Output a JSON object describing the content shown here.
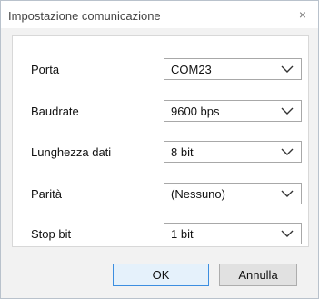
{
  "window": {
    "title": "Impostazione comunicazione",
    "close_glyph": "×"
  },
  "form": {
    "rows": [
      {
        "label": "Porta",
        "value": "COM23"
      },
      {
        "label": "Baudrate",
        "value": "9600 bps"
      },
      {
        "label": "Lunghezza dati",
        "value": "8 bit"
      },
      {
        "label": "Parità",
        "value": "(Nessuno)"
      },
      {
        "label": "Stop bit",
        "value": "1 bit"
      }
    ]
  },
  "buttons": {
    "ok_label": "OK",
    "cancel_label": "Annulla"
  },
  "colors": {
    "ok_border": "#3c8ee0"
  }
}
